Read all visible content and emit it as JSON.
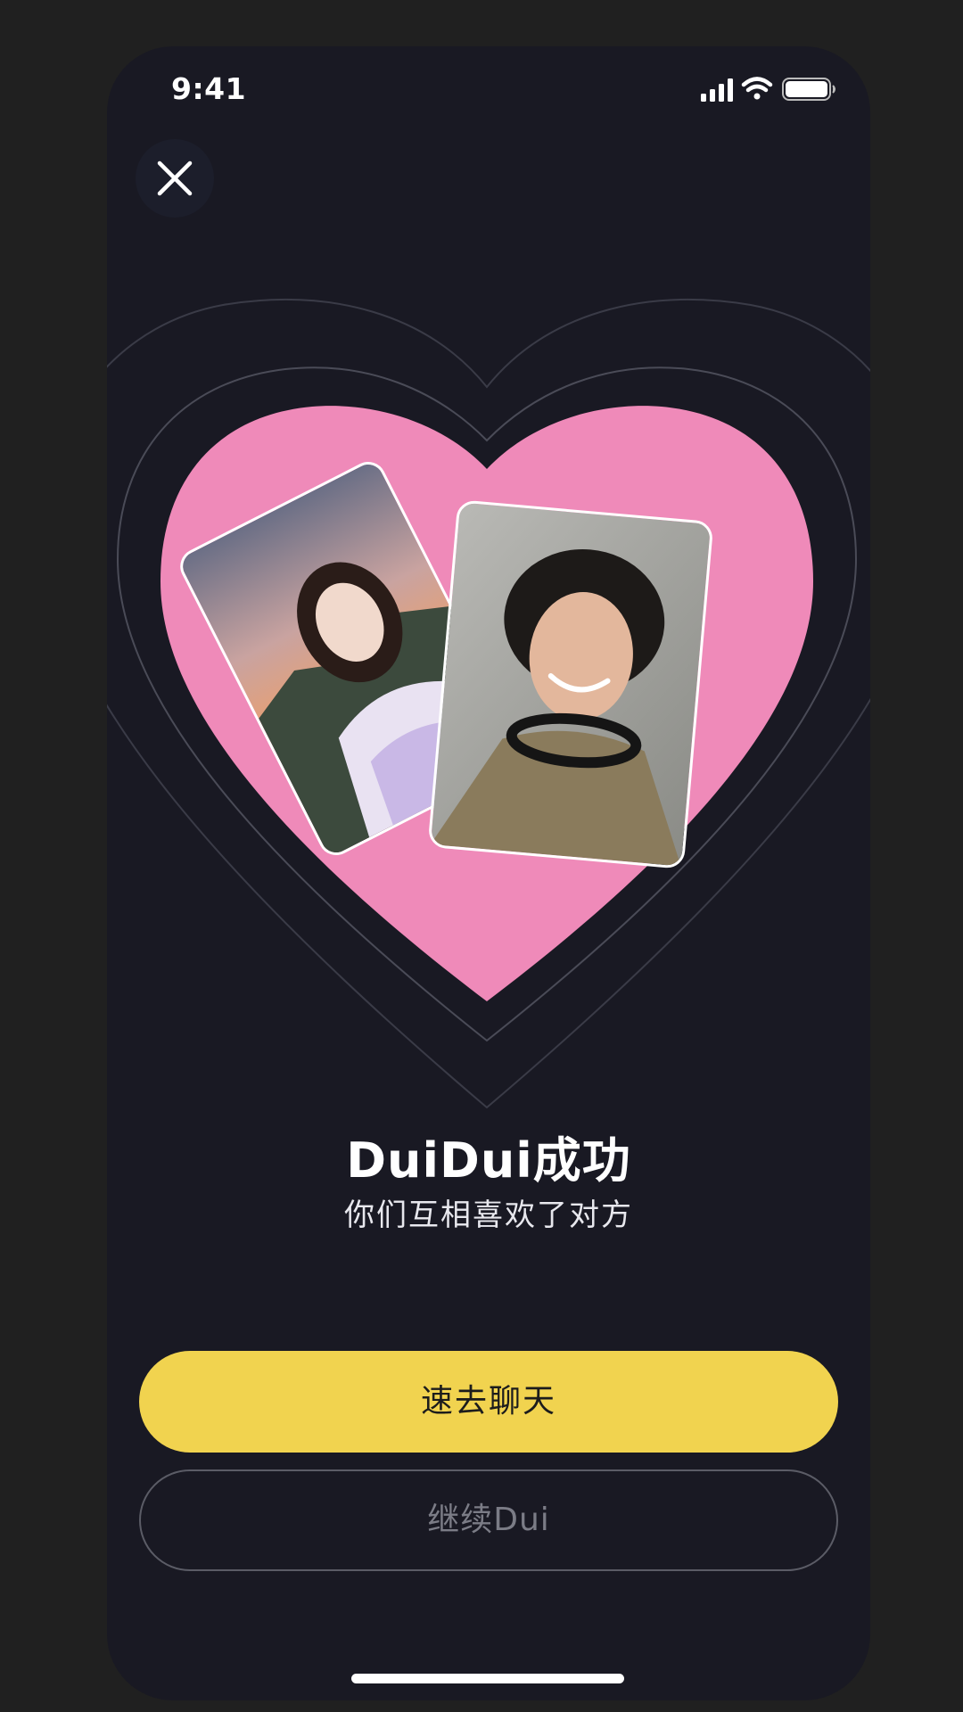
{
  "status_bar": {
    "time": "9:41",
    "icons": [
      "cellular-signal-icon",
      "wifi-icon",
      "battery-icon"
    ]
  },
  "close_button": {
    "icon": "close-icon"
  },
  "match": {
    "title": "DuiDui成功",
    "subtitle": "你们互相喜欢了对方",
    "heart_color": "#ef8ab9",
    "photos": [
      "portrait-woman-long-hair-sunset",
      "portrait-person-curly-hair-headphones"
    ]
  },
  "actions": {
    "primary_label": "速去聊天",
    "secondary_label": "继续Dui",
    "primary_color": "#f1d34f"
  },
  "colors": {
    "background": "#191923",
    "accent": "#f1d34f",
    "heart": "#ef8ab9"
  }
}
